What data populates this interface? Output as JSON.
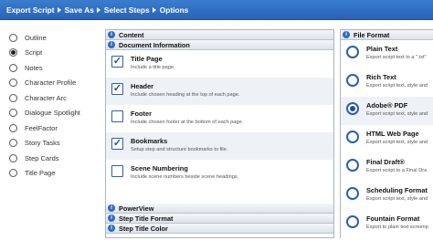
{
  "breadcrumb": [
    "Export Script",
    "Save As",
    "Select Steps",
    "Options"
  ],
  "left_options": {
    "items": [
      "Outline",
      "Script",
      "Notes",
      "Character Profile",
      "Character Arc",
      "Dialogue Spotlight",
      "FeelFactor",
      "Story Tasks",
      "Step Cards",
      "Title Page"
    ],
    "selected": "Script"
  },
  "middle": {
    "content_header": "Content",
    "doc_info_header": "Document Information",
    "options": [
      {
        "title": "Title Page",
        "desc": "Include a title page.",
        "checked": true
      },
      {
        "title": "Header",
        "desc": "Include chosen heading at the top of each page.",
        "checked": true
      },
      {
        "title": "Footer",
        "desc": "Include chosen footer at the bottom of each page.",
        "checked": false
      },
      {
        "title": "Bookmarks",
        "desc": "Setup step and structure bookmarks to file.",
        "checked": true
      },
      {
        "title": "Scene Numbering",
        "desc": "Include scene numbers beside scene headings.",
        "checked": false
      }
    ],
    "collapsed_sections": [
      "PowerView",
      "Step Title Format",
      "Step Title Color"
    ],
    "section_icon": "info-circle-icon"
  },
  "file_format": {
    "header": "File Format",
    "formats": [
      {
        "title": "Plain Text",
        "desc": "Export script text to a \".txt\""
      },
      {
        "title": "Rich Text",
        "desc": "Export script text, style and"
      },
      {
        "title": "Adobe® PDF",
        "desc": "Export script text, style and"
      },
      {
        "title": "HTML Web Page",
        "desc": "Export script text, style and"
      },
      {
        "title": "Final Draft®",
        "desc": "Export script to a Final Dra"
      },
      {
        "title": "Scheduling Format",
        "desc": "Export script text, style and"
      },
      {
        "title": "Fountain Format",
        "desc": "Export to plain text screenp"
      }
    ],
    "selected": "Adobe® PDF"
  },
  "colors": {
    "accent": "#2a62b6",
    "checkbox": "#2a5fae",
    "panel_border": "#aab4c0"
  }
}
